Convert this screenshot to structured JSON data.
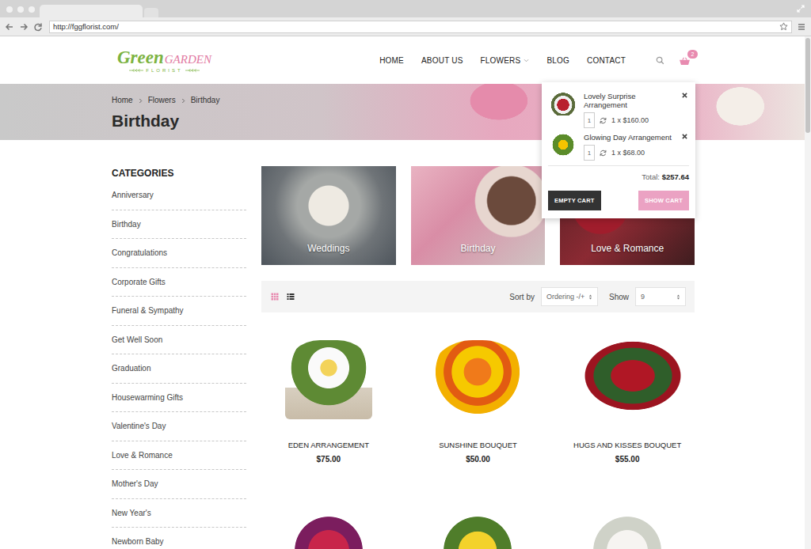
{
  "browser": {
    "url": "http://fggflorist.com/"
  },
  "logo": {
    "first": "Green",
    "second": "GARDEN",
    "tagline": "FLORIST"
  },
  "nav": [
    {
      "label": "HOME",
      "dropdown": false
    },
    {
      "label": "ABOUT US",
      "dropdown": false
    },
    {
      "label": "FLOWERS",
      "dropdown": true
    },
    {
      "label": "BLOG",
      "dropdown": false
    },
    {
      "label": "CONTACT",
      "dropdown": false
    }
  ],
  "cart": {
    "count": "2",
    "open": true,
    "items": [
      {
        "name": "Lovely Surprise Arrangement",
        "qty": "1",
        "line": "1 x $160.00"
      },
      {
        "name": "Glowing Day Arrangement",
        "qty": "1",
        "line": "1 x $68.00"
      }
    ],
    "total_label": "Total:",
    "total": "$257.64",
    "empty_button": "EMPTY CART",
    "show_button": "SHOW CART"
  },
  "breadcrumb": [
    "Home",
    "Flowers",
    "Birthday"
  ],
  "page_title": "Birthday",
  "sidebar": {
    "title": "CATEGORIES",
    "items": [
      "Anniversary",
      "Birthday",
      "Congratulations",
      "Corporate Gifts",
      "Funeral & Sympathy",
      "Get Well Soon",
      "Graduation",
      "Housewarming Gifts",
      "Valentine's Day",
      "Love & Romance",
      "Mother's Day",
      "New Year's",
      "Newborn Baby"
    ]
  },
  "tiles": [
    {
      "label": "Weddings"
    },
    {
      "label": "Birthday"
    },
    {
      "label": "Love & Romance"
    }
  ],
  "toolbar": {
    "views": [
      {
        "kind": "grid",
        "selected": true
      },
      {
        "kind": "list",
        "selected": false
      }
    ],
    "sort_label": "Sort by",
    "sort_value": "Ordering -/+",
    "show_label": "Show",
    "show_value": "9"
  },
  "products": [
    {
      "name": "EDEN ARRANGEMENT",
      "price": "$75.00"
    },
    {
      "name": "SUNSHINE BOUQUET",
      "price": "$50.00"
    },
    {
      "name": "HUGS AND KISSES BOUQUET",
      "price": "$55.00"
    }
  ]
}
